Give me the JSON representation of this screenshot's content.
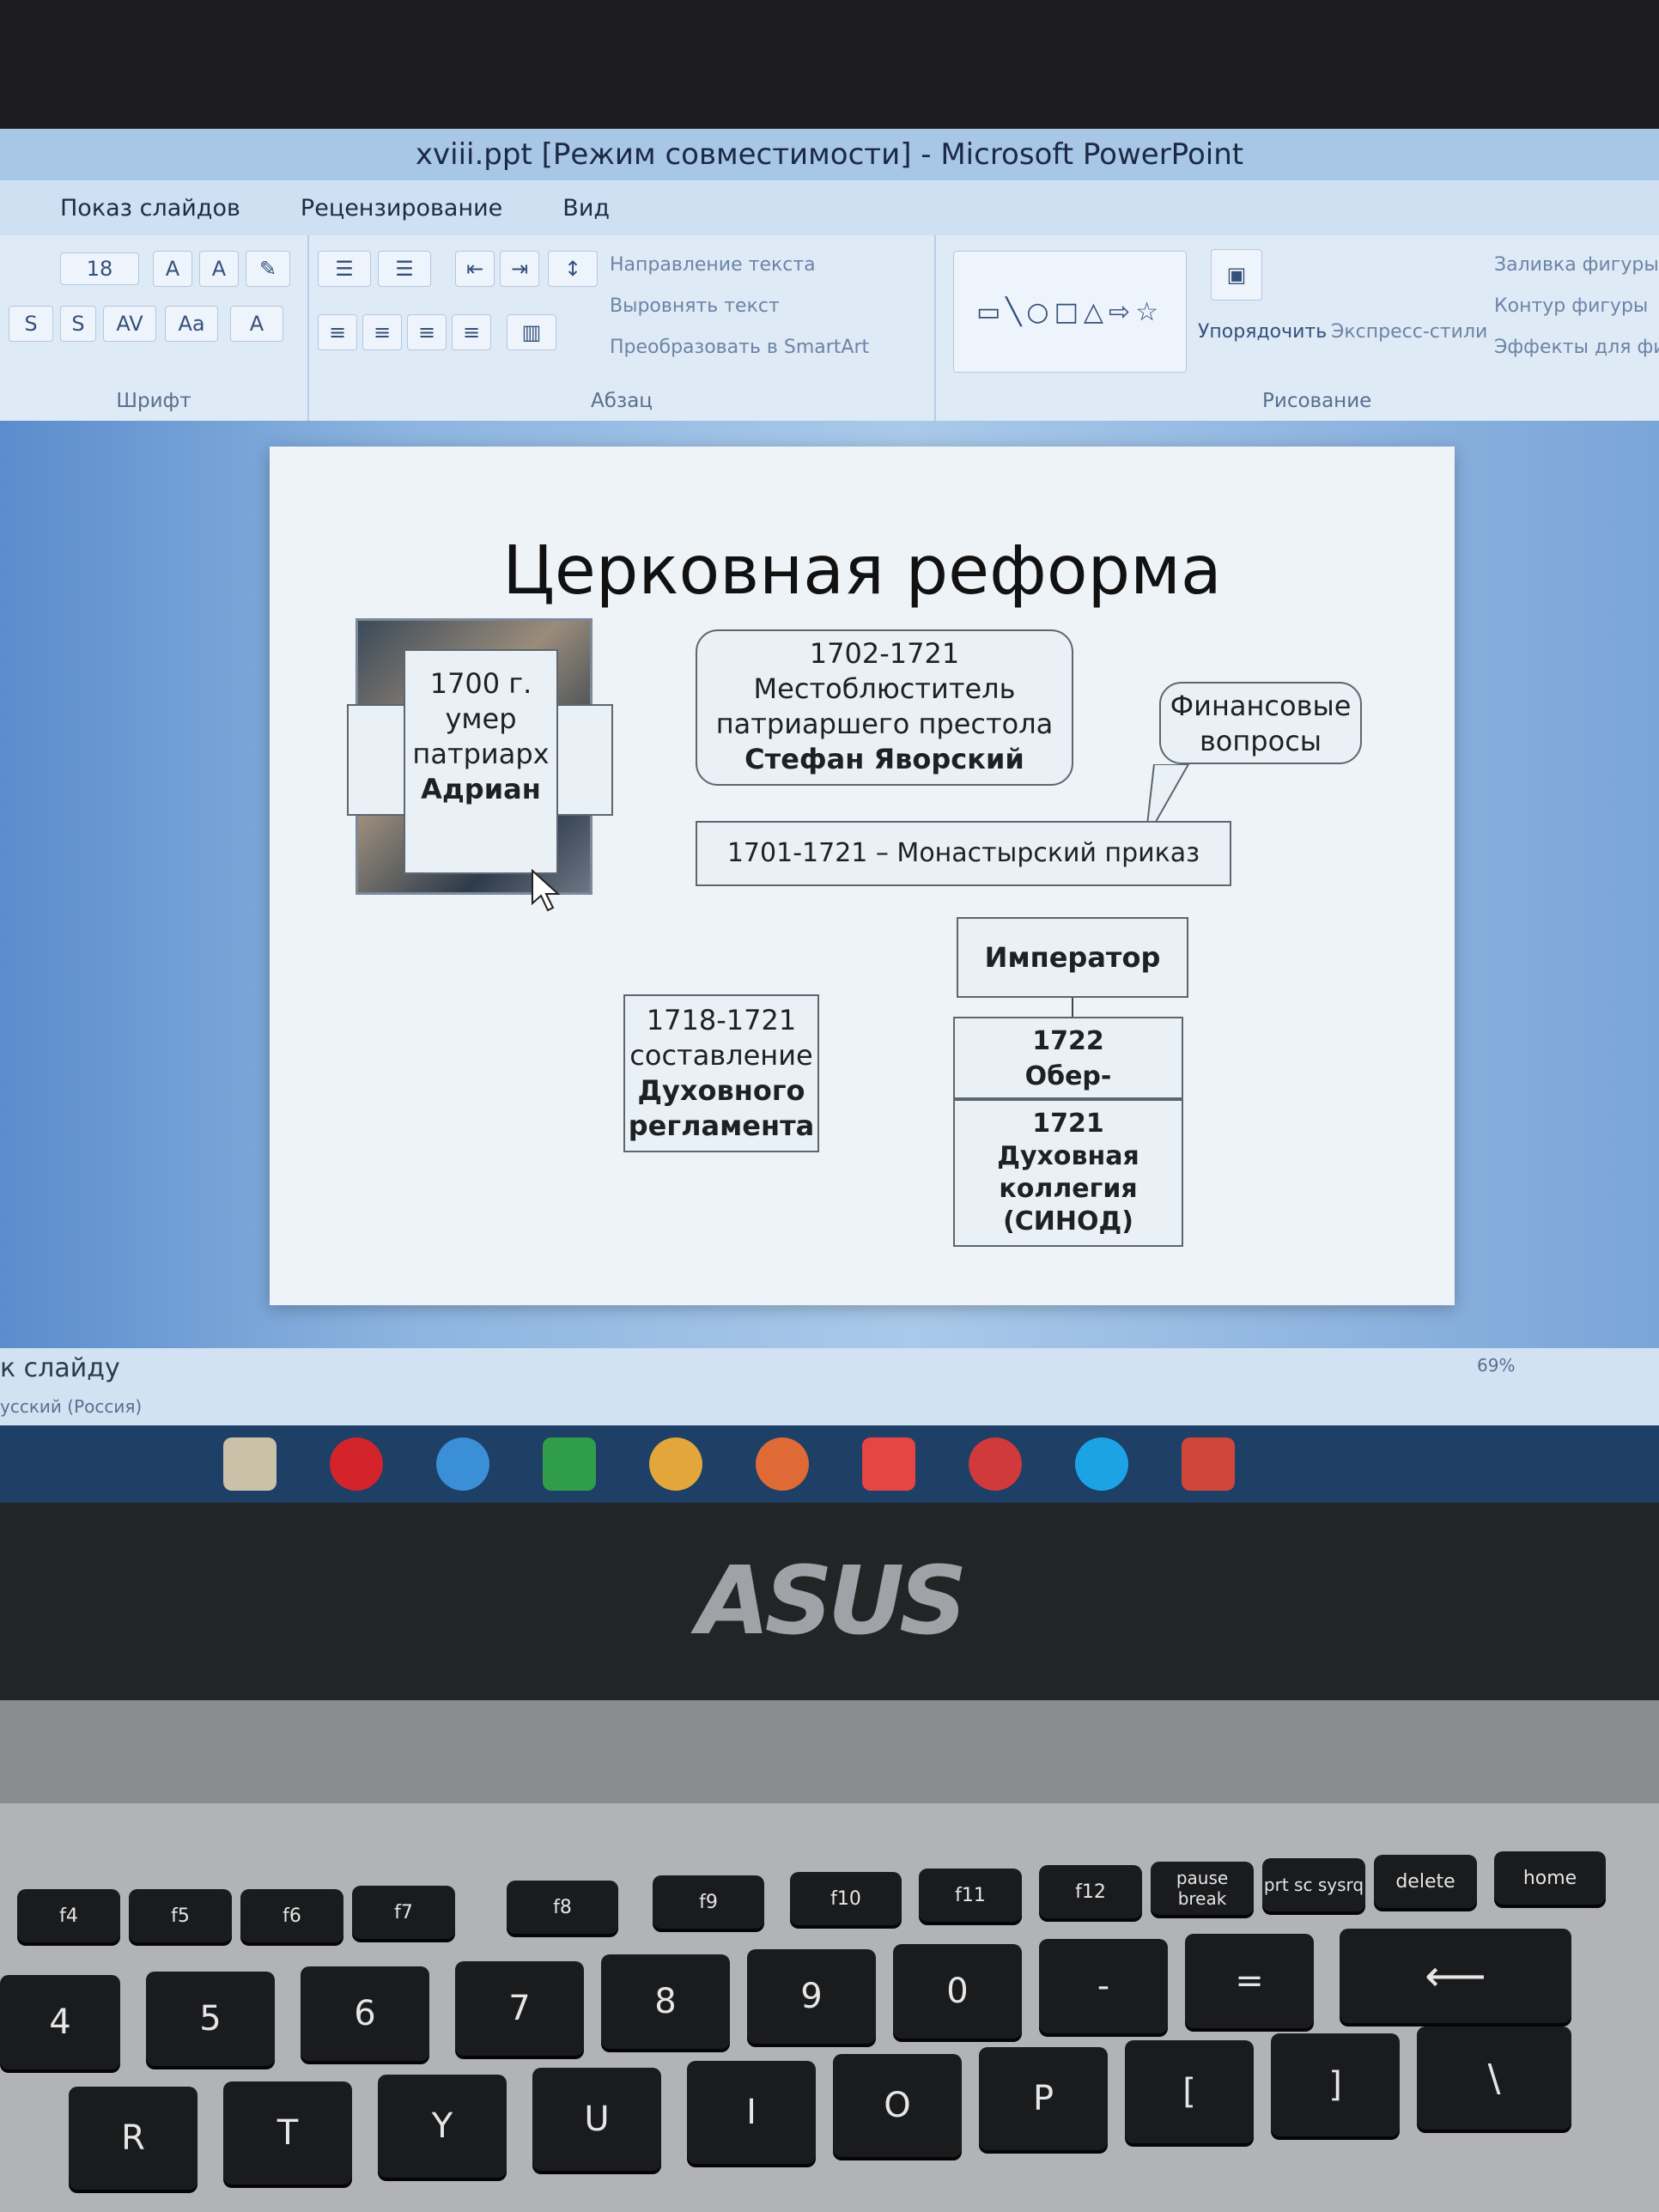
{
  "window": {
    "title": "xviii.ppt [Режим совместимости] - Microsoft PowerPoint"
  },
  "menu": {
    "items": [
      "Показ слайдов",
      "Рецензирование",
      "Вид"
    ]
  },
  "ribbon": {
    "font_size": "18",
    "groups": {
      "font": "Шрифт",
      "paragraph": "Абзац",
      "drawing": "Рисование"
    },
    "paragraph_cmds": [
      "Направление текста",
      "Выровнять текст",
      "Преобразовать в SmartArt"
    ],
    "arrange_label": "Упорядочить",
    "quick_styles_label": "Экспресс-стили",
    "shape_cmds": [
      "Заливка фигуры",
      "Контур фигуры",
      "Эффекты для фигуры"
    ]
  },
  "slide": {
    "title": "Церковная реформа",
    "box_adrian": [
      "1700 г.",
      "умер",
      "патриарх",
      "Адриан"
    ],
    "box_yavorsky": [
      "1702-1721",
      "Местоблюститель",
      "патриаршего престола",
      "Стефан Яворский"
    ],
    "callout_finance": [
      "Финансовые",
      "вопросы"
    ],
    "box_monastery": "1701-1721 – Монастырский приказ",
    "box_emperor": "Император",
    "box_reglament": [
      "1718-1721",
      "составление",
      "Духовного",
      "регламента"
    ],
    "box_oberprokuror": [
      "1722",
      "Обер-прокурор"
    ],
    "box_synod": [
      "1721",
      "Духовная",
      "коллегия",
      "(СИНОД)"
    ]
  },
  "status": {
    "notes_hint": "к слайду",
    "language": "усский (Россия)",
    "zoom": "69%"
  },
  "laptop": {
    "brand": "ASUS"
  },
  "keyboard": {
    "fkeys": [
      "f4",
      "f5",
      "f6",
      "f7",
      "f8",
      "f9",
      "f10",
      "f11",
      "f12",
      "pause break",
      "prt sc sysrq",
      "delete",
      "home"
    ],
    "numbers": [
      "4",
      "5",
      "6",
      "7",
      "8",
      "9",
      "0",
      "-",
      "="
    ],
    "letters": [
      "R",
      "T",
      "Y",
      "U",
      "I",
      "O",
      "P",
      "[",
      "]"
    ]
  },
  "colors": {
    "taskbar": "#1e3f66",
    "ribbon": "#dfeaf7",
    "slide_bg": "#eef3f8"
  }
}
